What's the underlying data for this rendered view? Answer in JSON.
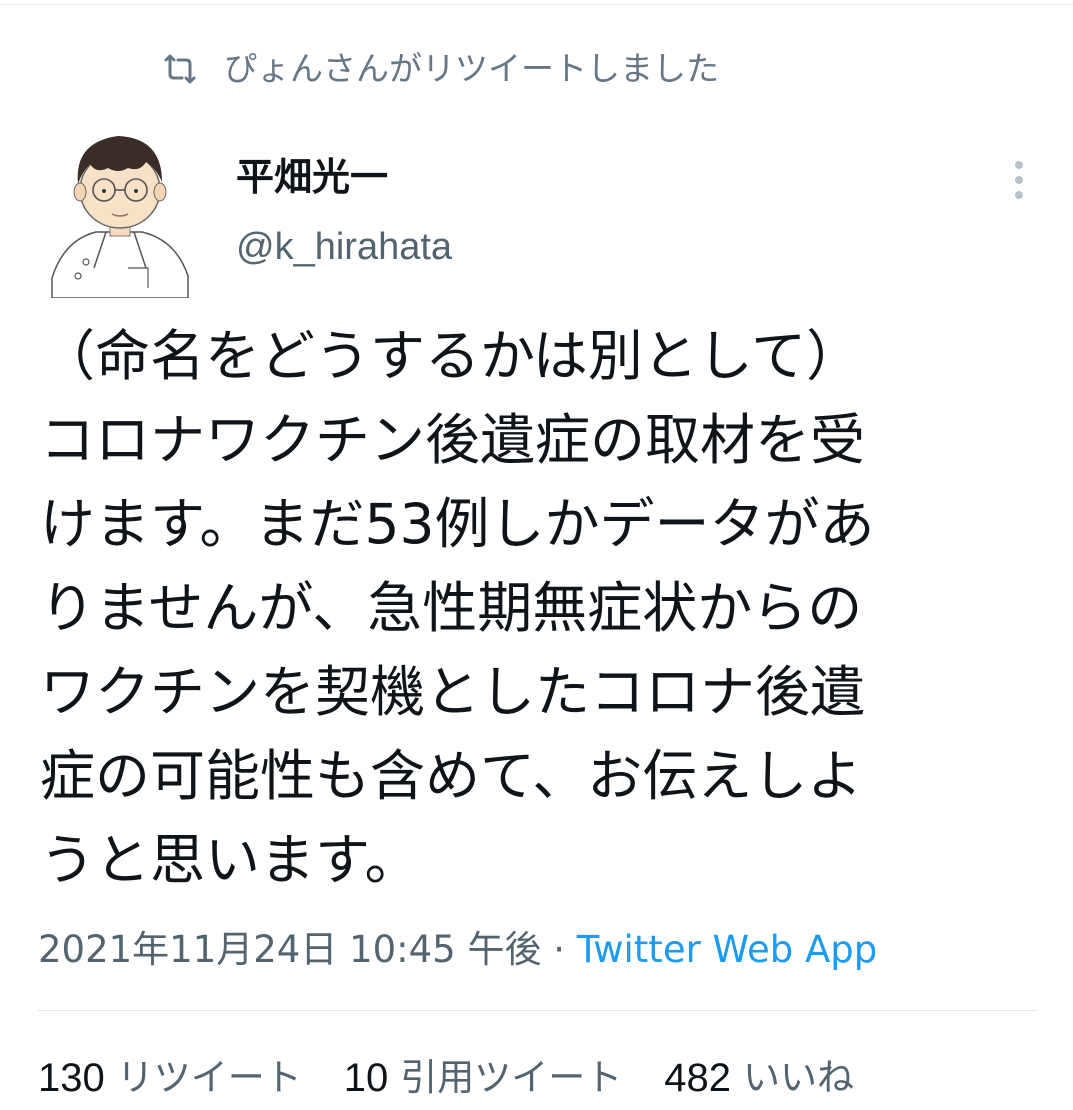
{
  "retweet_context": {
    "text": "ぴょんさんがリツイートしました",
    "icon": "retweet-icon"
  },
  "author": {
    "name": "平畑光一",
    "handle": "@k_hirahata"
  },
  "tweet": {
    "text": "（命名をどうするかは別として）\nコロナワクチン後遺症の取材を受\nけます。まだ53例しかデータがあ\nりませんが、急性期無症状からの\nワクチンを契機としたコロナ後遺\n症の可能性も含めて、お伝えしよ\nうと思います。",
    "timestamp": "2021年11月24日 10:45 午後",
    "separator": "·",
    "source": "Twitter Web App"
  },
  "stats": {
    "retweets_count": "130",
    "retweets_label": "リツイート",
    "quotes_count": "10",
    "quotes_label": "引用ツイート",
    "likes_count": "482",
    "likes_label": "いいね"
  },
  "colors": {
    "secondary_text": "#536471",
    "link": "#1d9bf0"
  }
}
